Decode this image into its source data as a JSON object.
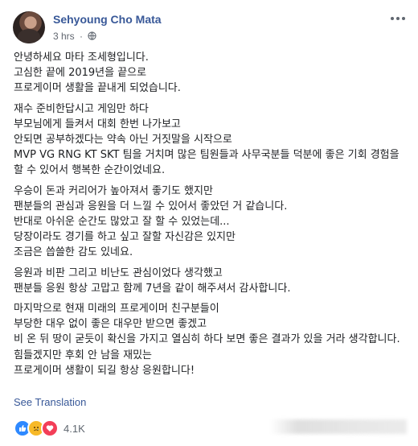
{
  "post": {
    "author": "Sehyoung Cho Mata",
    "time": "3 hrs",
    "separator": "·",
    "privacy_icon": "globe-icon",
    "options_icon": "more-options-icon",
    "paragraphs": [
      [
        "안녕하세요 마타 조세형입니다.",
        "고심한 끝에 2019년을 끝으로",
        "프로게이머 생활을 끝내게 되었습니다."
      ],
      [
        "재수 준비한답시고 게임만 하다",
        "부모님에게 들켜서 대회 한번 나가보고",
        "안되면 공부하겠다는 약속 아닌 거짓말을 시작으로",
        "MVP VG RNG KT SKT 팀을 거치며 많은 팀원들과 사무국분들 덕분에 좋은 기회 경험을 할 수 있어서 행복한 순간이었네요."
      ],
      [
        "우승이 돈과 커리어가 높아져서 좋기도 했지만",
        "팬분들의 관심과 응원을 더 느낄 수 있어서 좋았던 거 같습니다.",
        "반대로 아쉬운 순간도 많았고 잘 할 수 있었는데...",
        "당장이라도 경기를 하고 싶고 잘할 자신감은 있지만",
        "조금은 씁쓸한 감도 있네요."
      ],
      [
        "응원과 비판 그리고 비난도 관심이었다 생각했고",
        "팬분들 응원 항상 고맙고 함께 7년을 같이 해주셔서 감사합니다."
      ],
      [
        "마지막으로 현재 미래의 프로게이머 친구분들이",
        "부당한 대우 없이 좋은 대우만 받으면 좋겠고",
        "비 온 뒤 땅이 굳듯이 확신을 가지고 열심히 하다 보면 좋은 결과가 있을 거라 생각합니다.",
        "힘들겠지만 후회 안 남을 재밌는",
        "프로게이머 생활이 되길 항상 응원합니다!"
      ]
    ],
    "see_translation": "See Translation",
    "reactions": {
      "icons": [
        "like-icon",
        "sad-icon",
        "love-icon"
      ],
      "count": "4.1K"
    },
    "colors": {
      "author": "#385898",
      "link": "#385898",
      "text": "#1c1e21",
      "meta": "#616770",
      "like": "#2e89ff",
      "sad": "#f7b928",
      "love": "#f33e58"
    }
  }
}
